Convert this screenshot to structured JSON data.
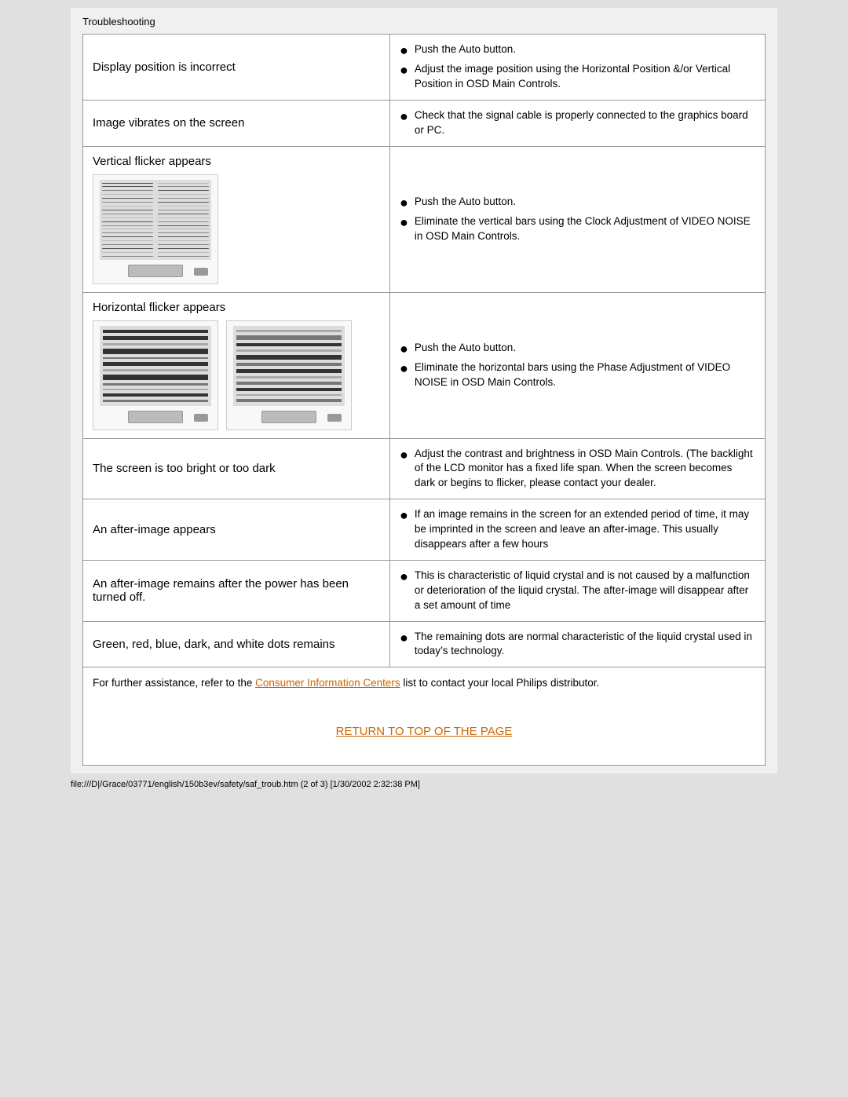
{
  "page": {
    "title": "Troubleshooting",
    "status_bar": "file:///D|/Grace/03771/english/150b3ev/safety/saf_troub.htm (2 of 3) [1/30/2002 2:32:38 PM]"
  },
  "table": {
    "rows": [
      {
        "id": "display-position",
        "left": "Display position is incorrect",
        "right": [
          "Push the Auto button.",
          "Adjust the image position using the Horizontal Position &/or Vertical Position in OSD Main Controls."
        ],
        "has_image": false
      },
      {
        "id": "image-vibrates",
        "left": "Image vibrates on the screen",
        "right": [
          "Check that the signal cable is properly connected to the graphics board or PC."
        ],
        "has_image": false
      },
      {
        "id": "vertical-flicker",
        "left": "Vertical flicker appears",
        "right": [
          "Push the Auto button.",
          "Eliminate the vertical bars using the Clock Adjustment of VIDEO NOISE in OSD Main Controls."
        ],
        "has_image": "vertical"
      },
      {
        "id": "horizontal-flicker",
        "left": "Horizontal flicker appears",
        "right": [
          "Push the Auto button.",
          "Eliminate the horizontal bars using the Phase Adjustment of VIDEO NOISE in OSD Main Controls."
        ],
        "has_image": "horizontal"
      },
      {
        "id": "too-bright",
        "left": "The screen is too bright or too dark",
        "right_no_bullet": "Adjust the contrast and brightness in OSD Main Controls. (The backlight of the LCD monitor has a fixed life span. When the screen becomes dark or begins to flicker, please contact your dealer.",
        "has_image": false
      },
      {
        "id": "after-image",
        "left": "An after-image appears",
        "right": [
          "If an image remains in the screen for an extended period of time, it may be imprinted in the screen and leave an after-image. This usually disappears after a few hours"
        ],
        "has_image": false
      },
      {
        "id": "after-image-power",
        "left": "An after-image remains after the power has been turned off.",
        "right": [
          "This is characteristic of liquid crystal and is not caused by a malfunction or deterioration of the liquid crystal. The after-image will disappear after a set amount of time"
        ],
        "has_image": false
      },
      {
        "id": "colored-dots",
        "left": "Green, red, blue, dark, and white dots remains",
        "right": [
          "The remaining dots are normal characteristic of the liquid crystal used in today’s technology."
        ],
        "has_image": false
      }
    ],
    "footer": {
      "text_before_link": "For further assistance, refer to the ",
      "link_text": "Consumer Information Centers",
      "text_after_link": " list to contact your local Philips distributor.",
      "return_text": "RETURN TO TOP OF THE PAGE"
    }
  }
}
